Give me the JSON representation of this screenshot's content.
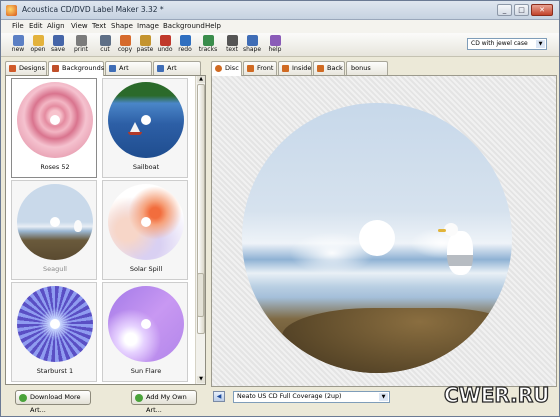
{
  "window": {
    "title": "Acoustica CD/DVD Label Maker 3.32 *"
  },
  "window_controls": {
    "minimize": "_",
    "maximize": "□",
    "close": "✕"
  },
  "menu": [
    "File",
    "Edit",
    "Align",
    "View",
    "Text",
    "Shape",
    "Image",
    "Background",
    "Help"
  ],
  "toolbar": [
    {
      "label": "new",
      "icon": "new-doc-icon",
      "color": "#5b7fc4"
    },
    {
      "label": "open",
      "icon": "open-folder-icon",
      "color": "#e3b23c"
    },
    {
      "label": "save",
      "icon": "save-disk-icon",
      "color": "#4565a8"
    },
    {
      "label": "print",
      "icon": "printer-icon",
      "color": "#7b7b7b"
    },
    {
      "label": "cut",
      "icon": "scissors-icon",
      "color": "#5e6f86"
    },
    {
      "label": "copy",
      "icon": "copy-icon",
      "color": "#d66a2c"
    },
    {
      "label": "paste",
      "icon": "paste-icon",
      "color": "#c4942f"
    },
    {
      "label": "undo",
      "icon": "undo-icon",
      "color": "#c0392b"
    },
    {
      "label": "redo",
      "icon": "redo-icon",
      "color": "#2f6fc0"
    },
    {
      "label": "tracks",
      "icon": "tracks-icon",
      "color": "#3a8d4c"
    },
    {
      "label": "text",
      "icon": "text-icon",
      "color": "#555555"
    },
    {
      "label": "shape",
      "icon": "shape-icon",
      "color": "#3f6db6"
    },
    {
      "label": "help",
      "icon": "help-icon",
      "color": "#8a5bb8"
    }
  ],
  "case_select": {
    "value": "CD with jewel case",
    "arrow": "▼"
  },
  "left_tabs": [
    {
      "label": "Designs",
      "icon": "designs-icon",
      "color": "#d05a2a"
    },
    {
      "label": "Backgrounds",
      "icon": "backgrounds-icon",
      "color": "#c04f2a"
    },
    {
      "label": "Art Browse",
      "icon": "art-browse-icon",
      "color": "#3f6db6"
    },
    {
      "label": "Art Search",
      "icon": "art-search-icon",
      "color": "#3f6db6"
    }
  ],
  "gallery": [
    {
      "caption": "Roses 52",
      "style": "roses"
    },
    {
      "caption": "Sailboat",
      "style": "sailboat"
    },
    {
      "caption": "Seagull",
      "style": "seagull"
    },
    {
      "caption": "Solar Spill",
      "style": "solar"
    },
    {
      "caption": "Starburst 1",
      "style": "starburst"
    },
    {
      "caption": "Sun Flare",
      "style": "sunflare"
    }
  ],
  "scroll": {
    "up": "▲",
    "down": "▼"
  },
  "buttons": {
    "download_more": "Download More Art...",
    "add_my_own": "Add My Own Art..."
  },
  "right_tabs": [
    {
      "label": "Disc",
      "icon": "disc-icon",
      "color": "#d06a22"
    },
    {
      "label": "Front",
      "icon": "front-icon",
      "color": "#d06a22"
    },
    {
      "label": "Inside",
      "icon": "inside-icon",
      "color": "#d06a22"
    },
    {
      "label": "Back",
      "icon": "back-icon",
      "color": "#d06a22"
    },
    {
      "label": "bonus sticker",
      "icon": "",
      "color": ""
    }
  ],
  "status": {
    "coverage": "Neato US CD Full Coverage (2up)",
    "arrow": "▼",
    "nav": "◀"
  },
  "watermark": {
    "text": "CWER.RU"
  }
}
